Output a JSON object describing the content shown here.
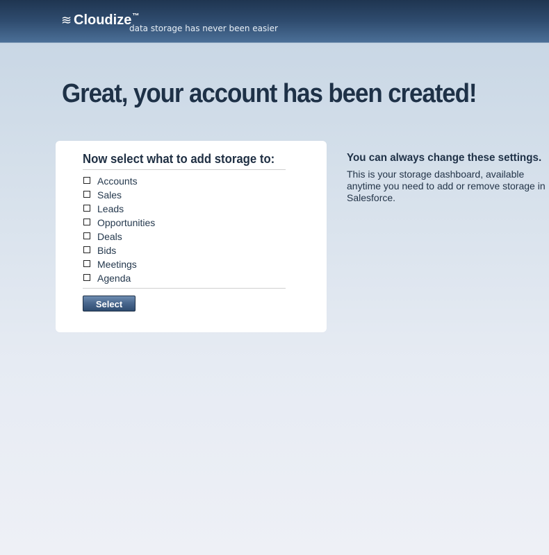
{
  "header": {
    "logo_mark": "≋",
    "brand": "Cloudize",
    "trademark": "™",
    "tagline": "data storage has never been easier"
  },
  "main": {
    "title": "Great, your account has been created!"
  },
  "storage_panel": {
    "title": "Now select what to add storage to:",
    "options": [
      {
        "label": "Accounts"
      },
      {
        "label": "Sales"
      },
      {
        "label": "Leads"
      },
      {
        "label": "Opportunities"
      },
      {
        "label": "Deals"
      },
      {
        "label": "Bids"
      },
      {
        "label": "Meetings"
      },
      {
        "label": "Agenda"
      }
    ],
    "button_label": "Select"
  },
  "info_panel": {
    "title": "You can always change these settings.",
    "text": "This is your storage dashboard, available anytime you need to add or remove storage in Salesforce."
  },
  "colors": {
    "header_dark": "#1f3550",
    "header_light": "#4b6f97",
    "background_top": "#c9d7e5",
    "background_bottom": "#eef0f6",
    "card": "#ffffff",
    "text_primary": "#1e3147",
    "button": "#4a688f"
  },
  "icons": {
    "logo": "cloud-waves-icon",
    "checkbox": "checkbox-empty-icon"
  }
}
